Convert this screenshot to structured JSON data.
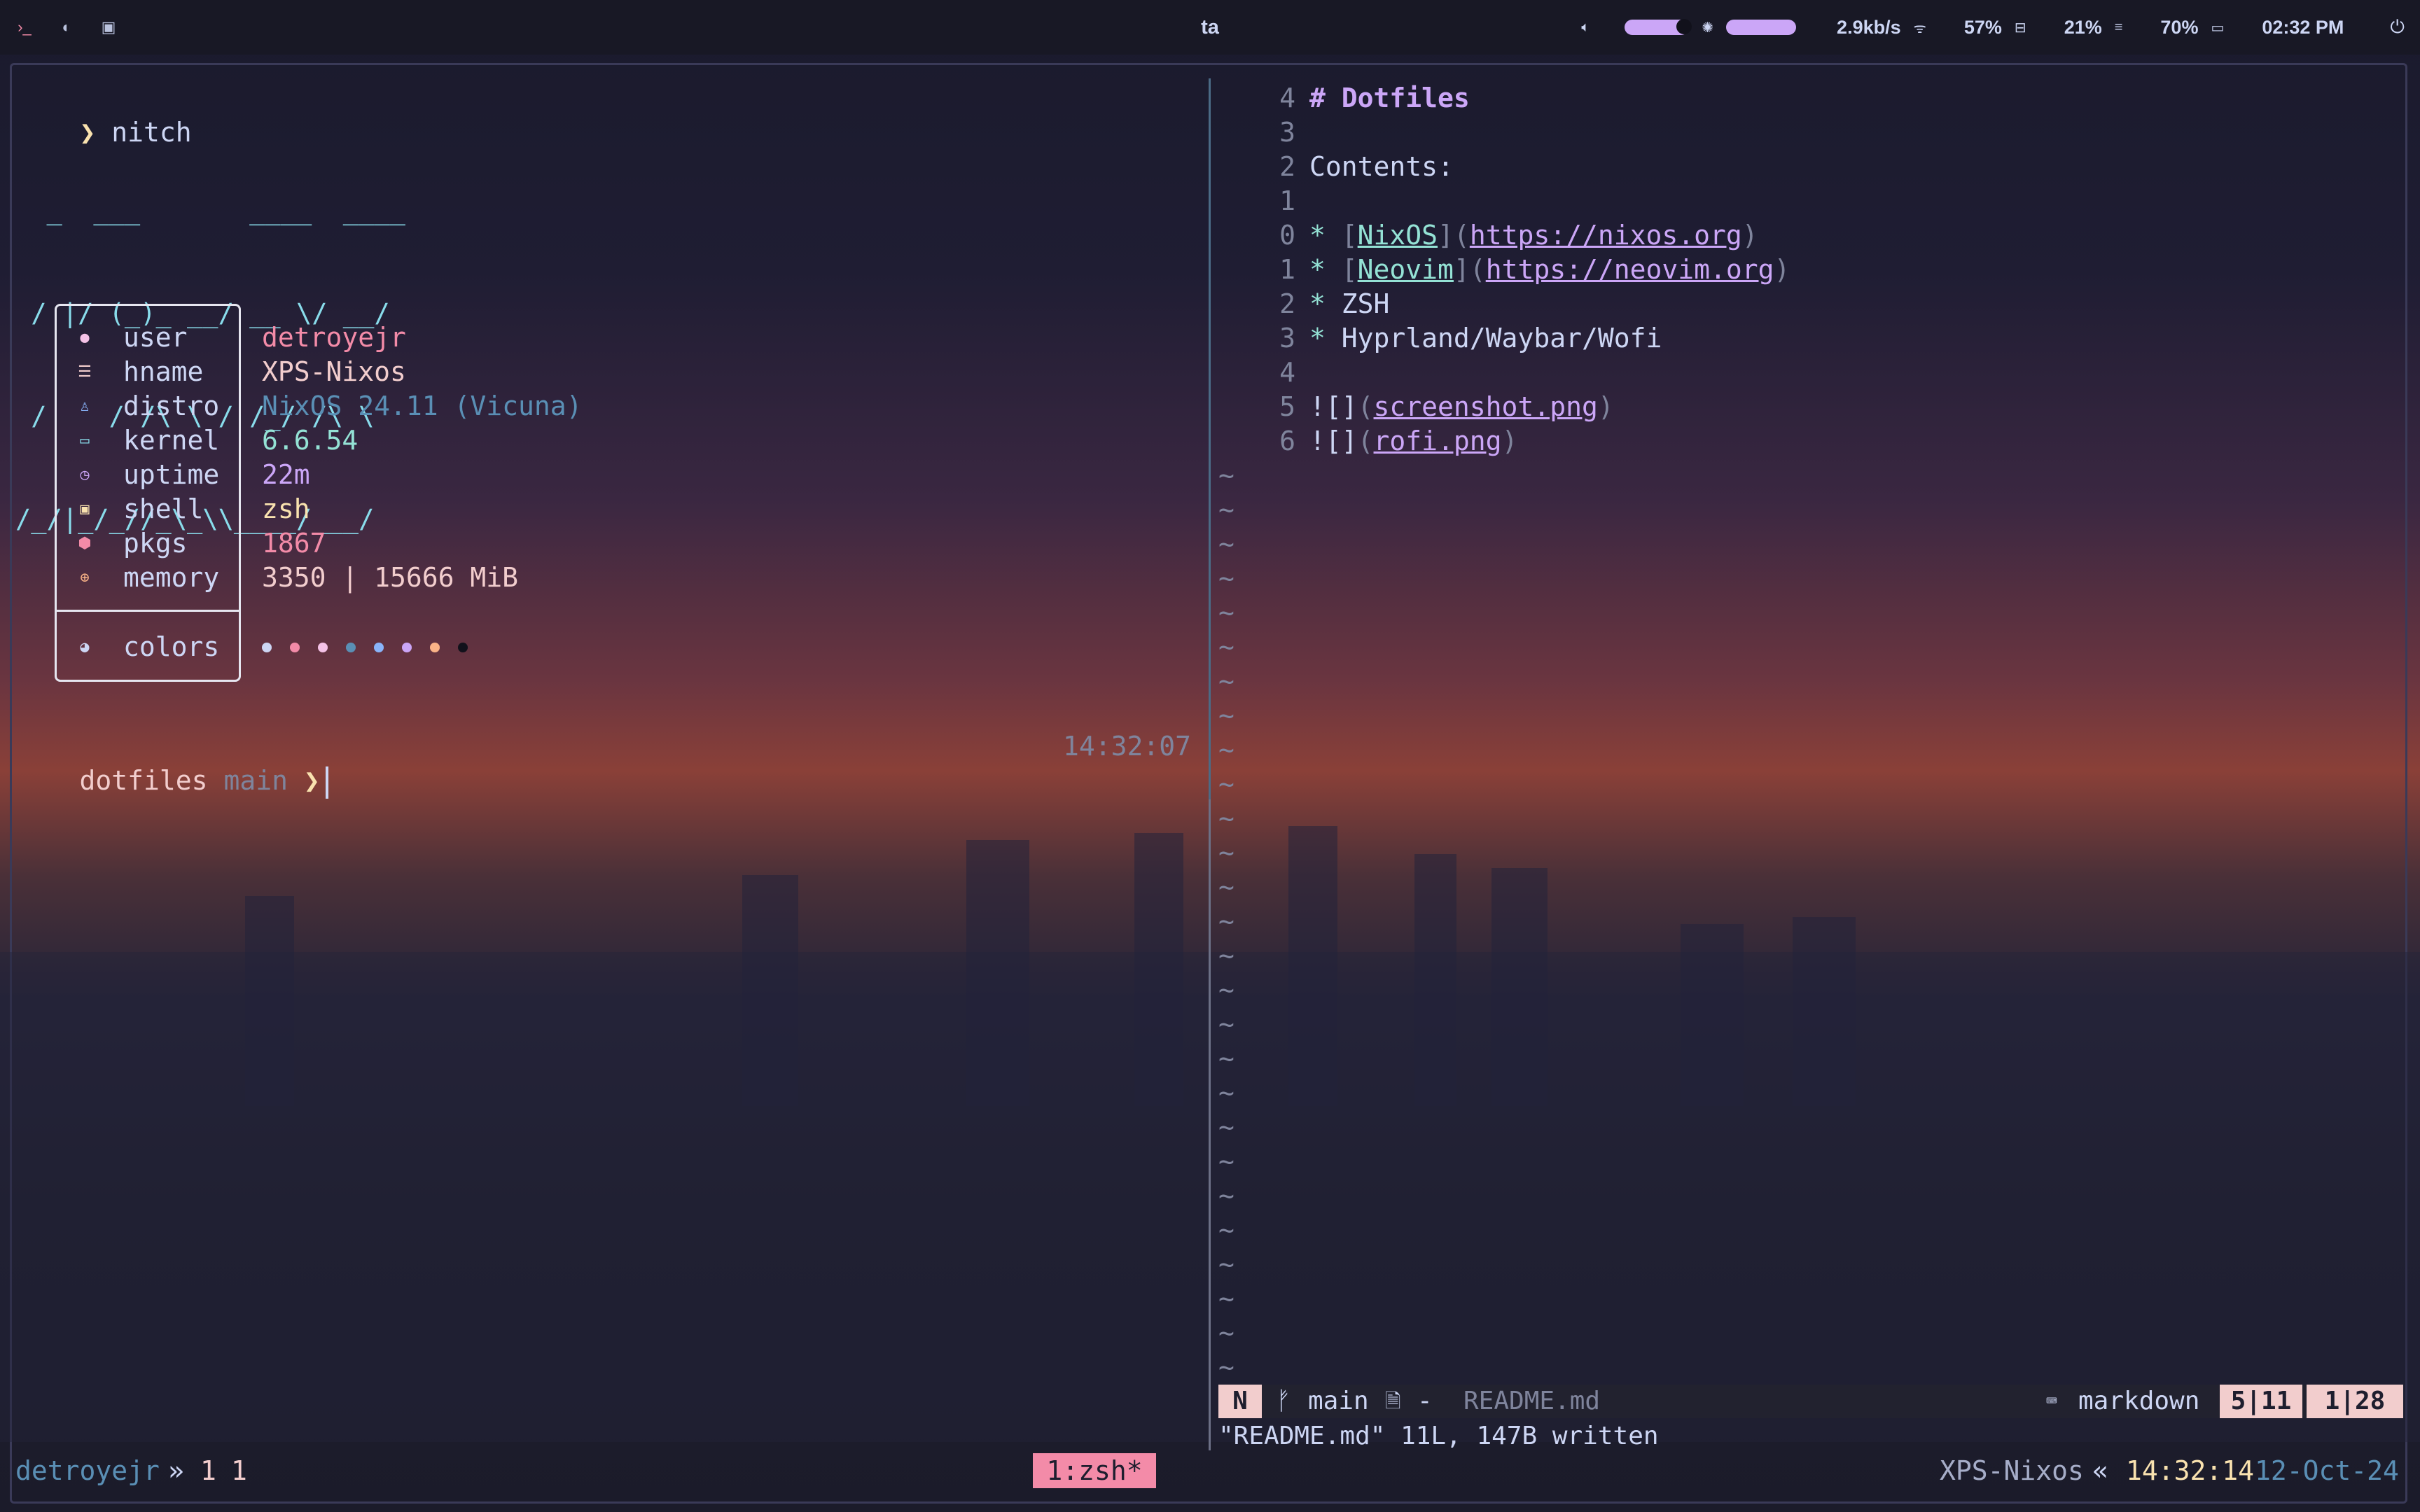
{
  "topbar": {
    "workspace_title": "ta",
    "network_speed": "2.9kb/s",
    "cpu": "57%",
    "memory": "21%",
    "battery": "70%",
    "time": "02:32 PM",
    "volume_level": 0.85,
    "brightness_level": 1.0
  },
  "terminal": {
    "command_prompt_symbol": "❯",
    "command": "nitch",
    "ascii_art": [
      "  _  ___       ____  ____",
      " / |/ (_)_ __/ __ \\/ __/",
      " /    / /\\ \\ / /_/ /\\ \\",
      "/_/|_/_//_\\_\\\\____/___/"
    ],
    "info": [
      {
        "icon": "user-icon",
        "label": "user",
        "value": "detroyejr"
      },
      {
        "icon": "hostname-icon",
        "label": "hname",
        "value": "XPS-Nixos"
      },
      {
        "icon": "distro-icon",
        "label": "distro",
        "value": "NixOS 24.11 (Vicuna)"
      },
      {
        "icon": "kernel-icon",
        "label": "kernel",
        "value": "6.6.54"
      },
      {
        "icon": "uptime-icon",
        "label": "uptime",
        "value": "22m"
      },
      {
        "icon": "shell-icon",
        "label": "shell",
        "value": "zsh"
      },
      {
        "icon": "packages-icon",
        "label": "pkgs",
        "value": "1867"
      },
      {
        "icon": "memory-icon",
        "label": "memory",
        "value": "3350 | 15666 MiB"
      }
    ],
    "colors_label": "colors",
    "color_dots": [
      "#cdd6f4",
      "#f38ba8",
      "#f5c2e7",
      "#5a8fb5",
      "#89b4fa",
      "#cba6f7",
      "#fab387",
      "#11111b"
    ],
    "prompt": {
      "dir": "dotfiles",
      "branch": "main",
      "symbol": "❯",
      "time": "14:32:07"
    }
  },
  "editor": {
    "lines": [
      {
        "num": "4",
        "text": "# Dotfiles"
      },
      {
        "num": "3",
        "text": ""
      },
      {
        "num": "2",
        "text": "Contents:"
      },
      {
        "num": "1",
        "text": ""
      },
      {
        "num": "0",
        "bullet": "*",
        "label": "NixOS",
        "url": "https://nixos.org"
      },
      {
        "num": "1",
        "bullet": "*",
        "label": "Neovim",
        "url": "https://neovim.org"
      },
      {
        "num": "2",
        "bullet": "*",
        "text": "ZSH"
      },
      {
        "num": "3",
        "bullet": "*",
        "text": "Hyprland/Waybar/Wofi"
      },
      {
        "num": "4",
        "text": ""
      },
      {
        "num": "5",
        "image_prefix": "![]",
        "url": "screenshot.png"
      },
      {
        "num": "6",
        "image_prefix": "![]",
        "url": "rofi.png"
      }
    ],
    "tilde": "~",
    "statusline": {
      "mode": "N",
      "branch": "main",
      "file_flag": "-",
      "filename": "README.md",
      "filetype": "markdown",
      "position": "5|11",
      "column": "1|28"
    },
    "message": "\"README.md\" 11L, 147B written"
  },
  "tmux": {
    "session_user": "detroyejr",
    "separator": "»",
    "window_index": "1",
    "pane_index": "1",
    "active_window": "1:zsh*",
    "host": "XPS-Nixos",
    "host_sep": "«",
    "time": "14:32:14",
    "date": "12-Oct-24"
  }
}
